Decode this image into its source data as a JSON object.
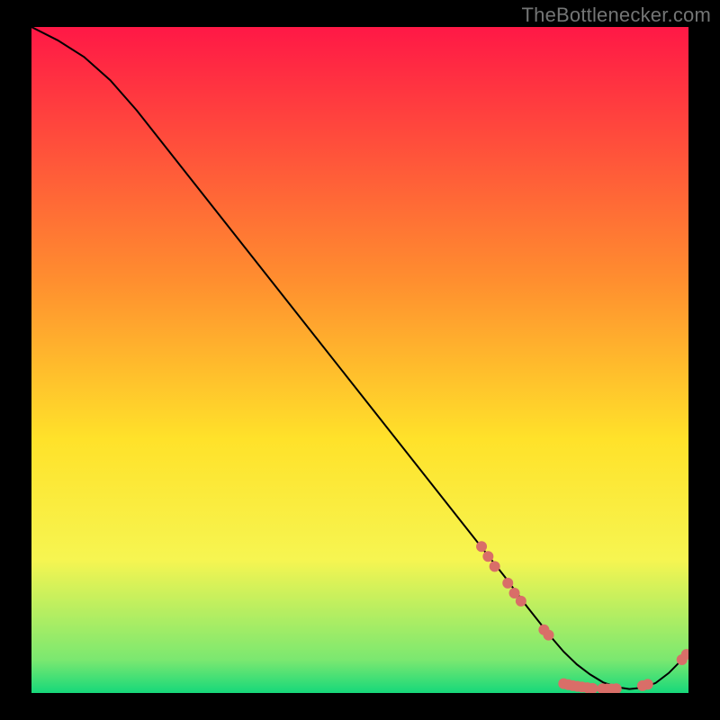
{
  "watermark": "TheBottlenecker.com",
  "chart_data": {
    "type": "line",
    "title": "",
    "xlabel": "",
    "ylabel": "",
    "xlim": [
      0,
      100
    ],
    "ylim": [
      0,
      100
    ],
    "background_gradient": {
      "top": "#ff1846",
      "mid_upper": "#ff8e2f",
      "mid": "#ffe22a",
      "mid_lower": "#f6f551",
      "near_bottom": "#7be870",
      "bottom": "#16d87a"
    },
    "series": [
      {
        "name": "bottleneck-curve",
        "x": [
          0,
          4,
          8,
          12,
          16,
          20,
          24,
          28,
          32,
          36,
          40,
          44,
          48,
          52,
          56,
          60,
          64,
          68,
          72,
          75,
          77,
          79,
          81,
          83,
          85,
          87,
          89,
          91,
          93,
          95,
          97,
          100
        ],
        "y": [
          100,
          98,
          95.5,
          92,
          87.5,
          82.5,
          77.5,
          72.5,
          67.5,
          62.5,
          57.5,
          52.5,
          47.5,
          42.5,
          37.5,
          32.5,
          27.5,
          22.5,
          17.5,
          13.5,
          11,
          8.5,
          6.2,
          4.3,
          2.8,
          1.6,
          0.9,
          0.6,
          0.8,
          1.5,
          3,
          6
        ]
      }
    ],
    "markers": [
      {
        "x": 68.5,
        "y": 22.0
      },
      {
        "x": 69.5,
        "y": 20.5
      },
      {
        "x": 70.5,
        "y": 19.0
      },
      {
        "x": 72.5,
        "y": 16.5
      },
      {
        "x": 73.5,
        "y": 15.0
      },
      {
        "x": 74.5,
        "y": 13.8
      },
      {
        "x": 78.0,
        "y": 9.5
      },
      {
        "x": 78.7,
        "y": 8.7
      },
      {
        "x": 81.0,
        "y": 1.4
      },
      {
        "x": 81.7,
        "y": 1.25
      },
      {
        "x": 82.4,
        "y": 1.1
      },
      {
        "x": 83.1,
        "y": 1.0
      },
      {
        "x": 83.8,
        "y": 0.9
      },
      {
        "x": 84.6,
        "y": 0.8
      },
      {
        "x": 85.4,
        "y": 0.7
      },
      {
        "x": 86.9,
        "y": 0.65
      },
      {
        "x": 87.6,
        "y": 0.6
      },
      {
        "x": 88.3,
        "y": 0.6
      },
      {
        "x": 89.0,
        "y": 0.65
      },
      {
        "x": 93.0,
        "y": 1.1
      },
      {
        "x": 93.8,
        "y": 1.3
      },
      {
        "x": 99.0,
        "y": 5.0
      },
      {
        "x": 99.7,
        "y": 5.8
      }
    ],
    "marker_color": "#d96e68",
    "line_color": "#000000"
  }
}
